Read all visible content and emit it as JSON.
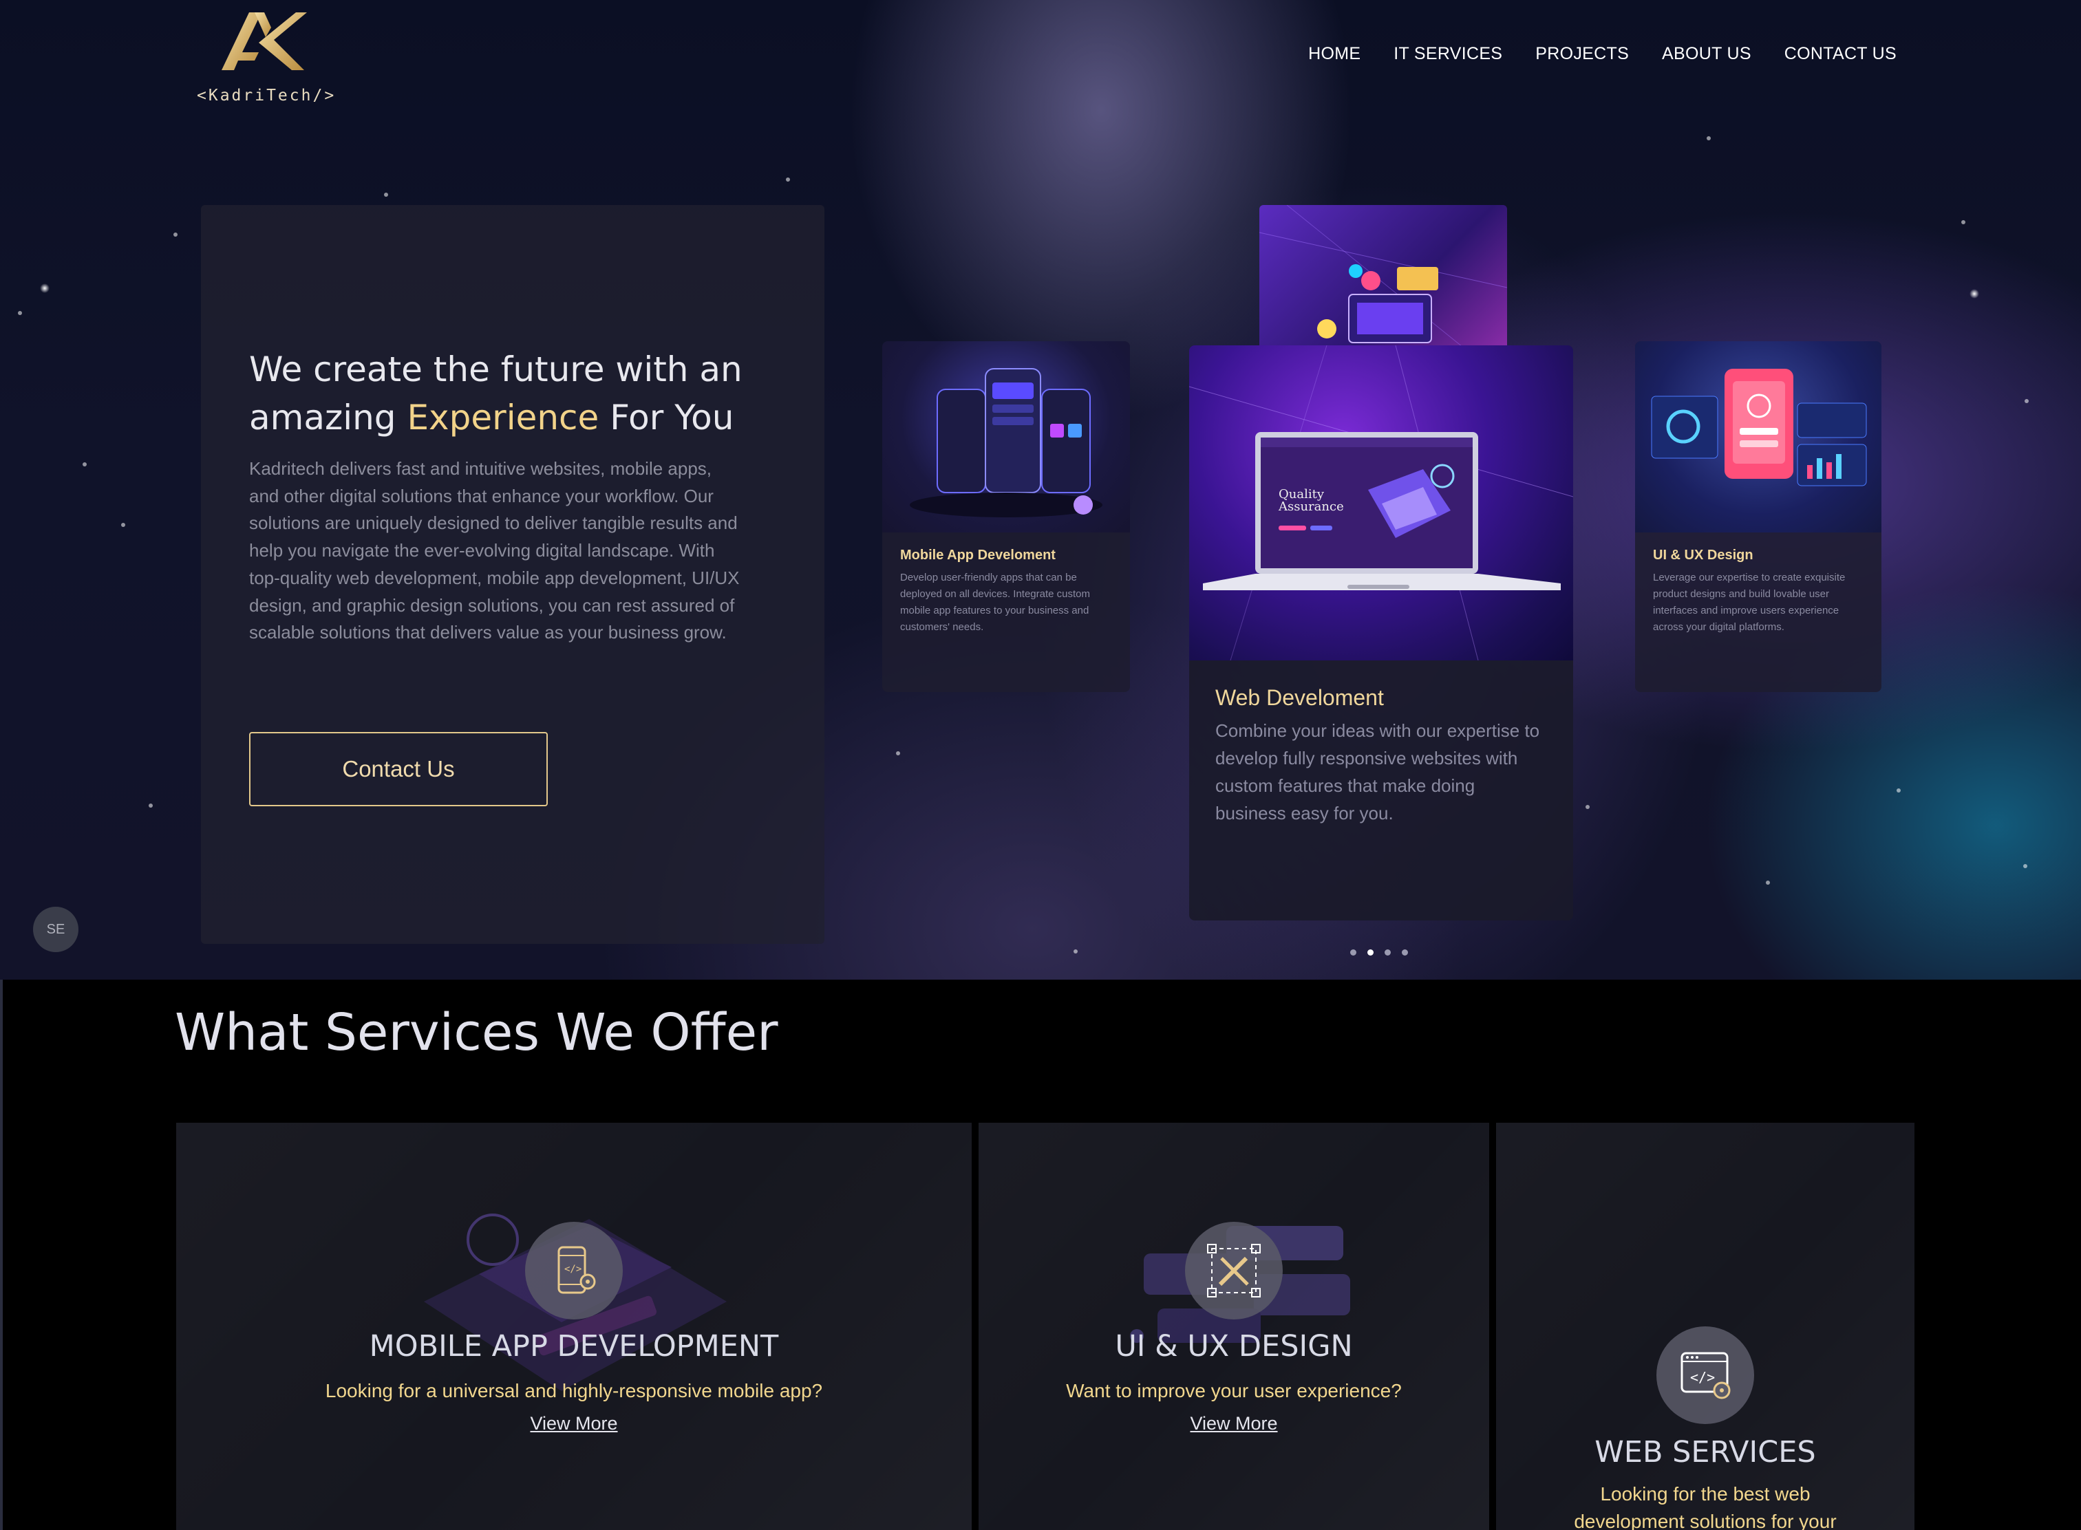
{
  "brand": {
    "logo_text": "<KadriTech/>",
    "accent": "#e3c88b"
  },
  "nav": {
    "items": [
      "HOME",
      "IT SERVICES",
      "PROJECTS",
      "ABOUT US",
      "CONTACT US"
    ]
  },
  "hero": {
    "title_line1": "We create the future with an",
    "title_pre": "amazing ",
    "title_accent": "Experience",
    "title_post": " For You",
    "description": "Kadritech delivers fast and intuitive websites, mobile apps, and other digital solutions that enhance your workflow. Our solutions are uniquely designed to deliver tangible results and help you navigate the ever-evolving digital landscape. With top-quality web development, mobile app development, UI/UX design, and graphic design solutions, you can rest assured of scalable solutions that delivers value as your business grow.",
    "cta_label": "Contact Us"
  },
  "carousel": {
    "cards": [
      {
        "title": "Mobile App Develoment",
        "text": "Develop user-friendly apps that can be deployed on all devices. Integrate custom mobile app features to your business and customers' needs."
      },
      {
        "title": "Web Develoment",
        "text": "Combine your ideas with our expertise to develop fully responsive websites with custom features that make doing business easy for you.",
        "image_text_1": "Quality",
        "image_text_2": "Assurance"
      },
      {
        "title": "UI & UX Design",
        "text": "Leverage our expertise to create exquisite product designs and build lovable user interfaces and improve users experience across your digital platforms."
      }
    ],
    "active_index": 1,
    "dot_count": 4
  },
  "widget": {
    "label": "SE"
  },
  "services": {
    "heading": "What Services We Offer",
    "items": [
      {
        "name": "MOBILE APP DEVELOPMENT",
        "tagline": "Looking for a universal and highly-responsive mobile app?",
        "link": "View More",
        "icon": "mobile-gear-icon"
      },
      {
        "name": "UI & UX DESIGN",
        "tagline": "Want to improve your user experience?",
        "link": "View More",
        "icon": "design-tools-icon"
      },
      {
        "name": "WEB SERVICES",
        "tagline": "Looking for the best web development solutions for your",
        "icon": "browser-code-icon"
      }
    ]
  }
}
